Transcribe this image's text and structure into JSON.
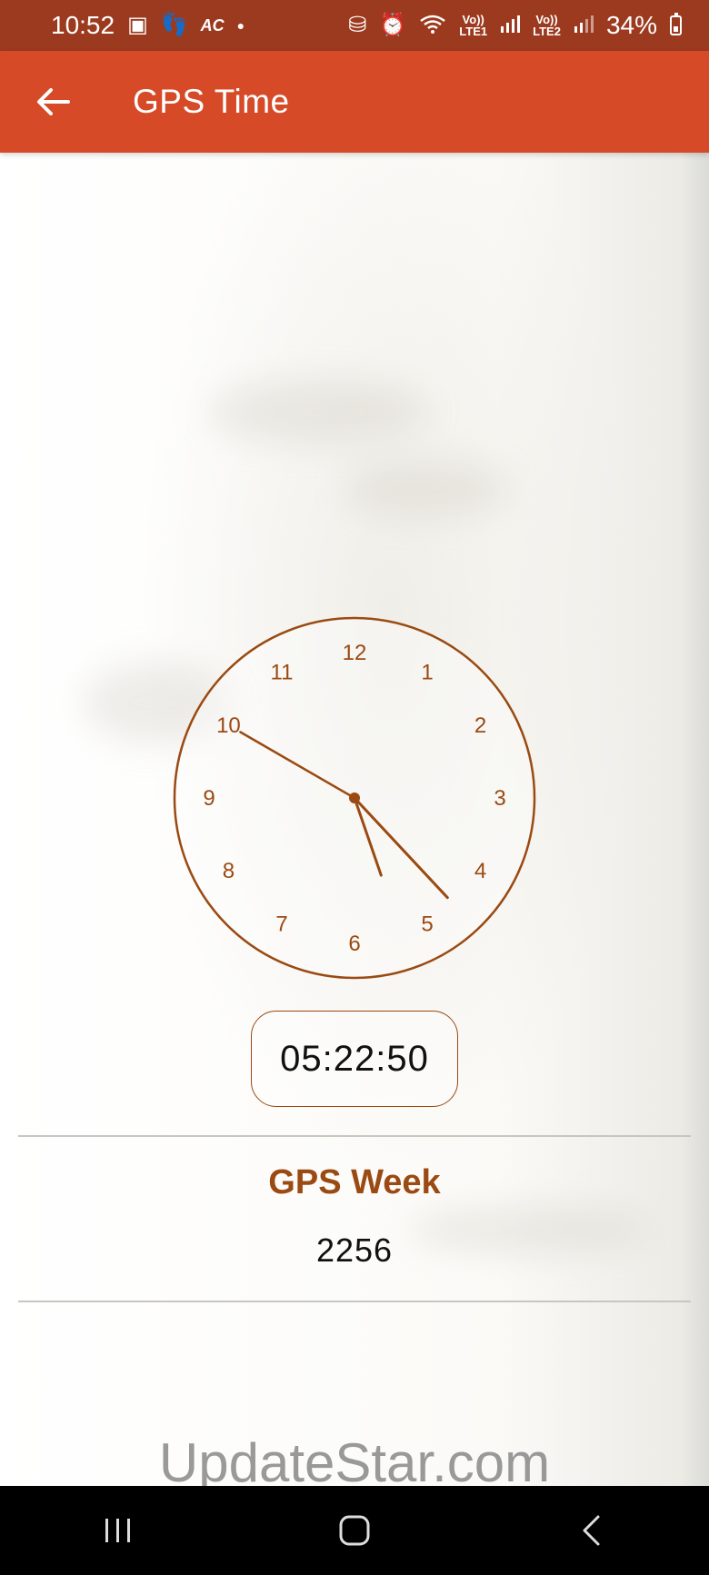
{
  "status_bar": {
    "time": "10:52",
    "network_labels": [
      "Vo))",
      "LTE1",
      "Vo))",
      "LTE2"
    ],
    "battery": "34%"
  },
  "app_bar": {
    "title": "GPS Time"
  },
  "clock": {
    "numbers": [
      "12",
      "1",
      "2",
      "3",
      "4",
      "5",
      "6",
      "7",
      "8",
      "9",
      "10",
      "11"
    ],
    "time": {
      "hours": 5,
      "minutes": 22,
      "seconds": 50
    },
    "color": "#9a4a12"
  },
  "time_display": "05:22:50",
  "gps_week": {
    "title": "GPS Week",
    "value": "2256"
  },
  "watermark": "UpdateStar.com",
  "colors": {
    "status_bar": "#9c3a1f",
    "app_bar": "#d64a28",
    "accent": "#9a4a12"
  }
}
